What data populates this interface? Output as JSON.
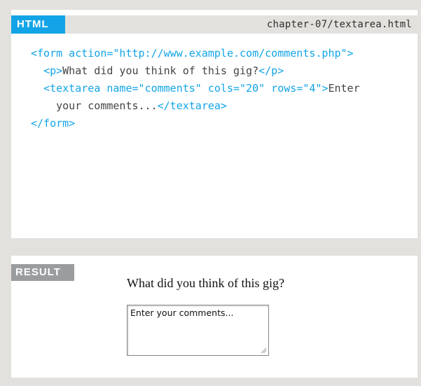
{
  "code_panel": {
    "tag": "HTML",
    "filename": "chapter-07/textarea.html",
    "lines": [
      [
        {
          "t": "<form action=\"http://www.example.com/comments.php\">",
          "c": "blue"
        }
      ],
      [
        {
          "t": "  ",
          "c": ""
        },
        {
          "t": "<p>",
          "c": "blue"
        },
        {
          "t": "What did you think of this gig?",
          "c": ""
        },
        {
          "t": "</p>",
          "c": "blue"
        }
      ],
      [
        {
          "t": "  ",
          "c": ""
        },
        {
          "t": "<textarea name=\"comments\" cols=\"20\" rows=\"4\">",
          "c": "blue"
        },
        {
          "t": "Enter",
          "c": ""
        }
      ],
      [
        {
          "t": "    your comments...",
          "c": ""
        },
        {
          "t": "</textarea>",
          "c": "blue"
        }
      ],
      [
        {
          "t": "</form>",
          "c": "blue"
        }
      ]
    ]
  },
  "result_panel": {
    "tag": "RESULT",
    "question": "What did you think of this gig?",
    "textarea_value": "Enter your comments..."
  },
  "colors": {
    "accent_blue": "#12a4e6",
    "result_gray": "#9b9c9e",
    "page_bg": "#e3e1dd"
  }
}
